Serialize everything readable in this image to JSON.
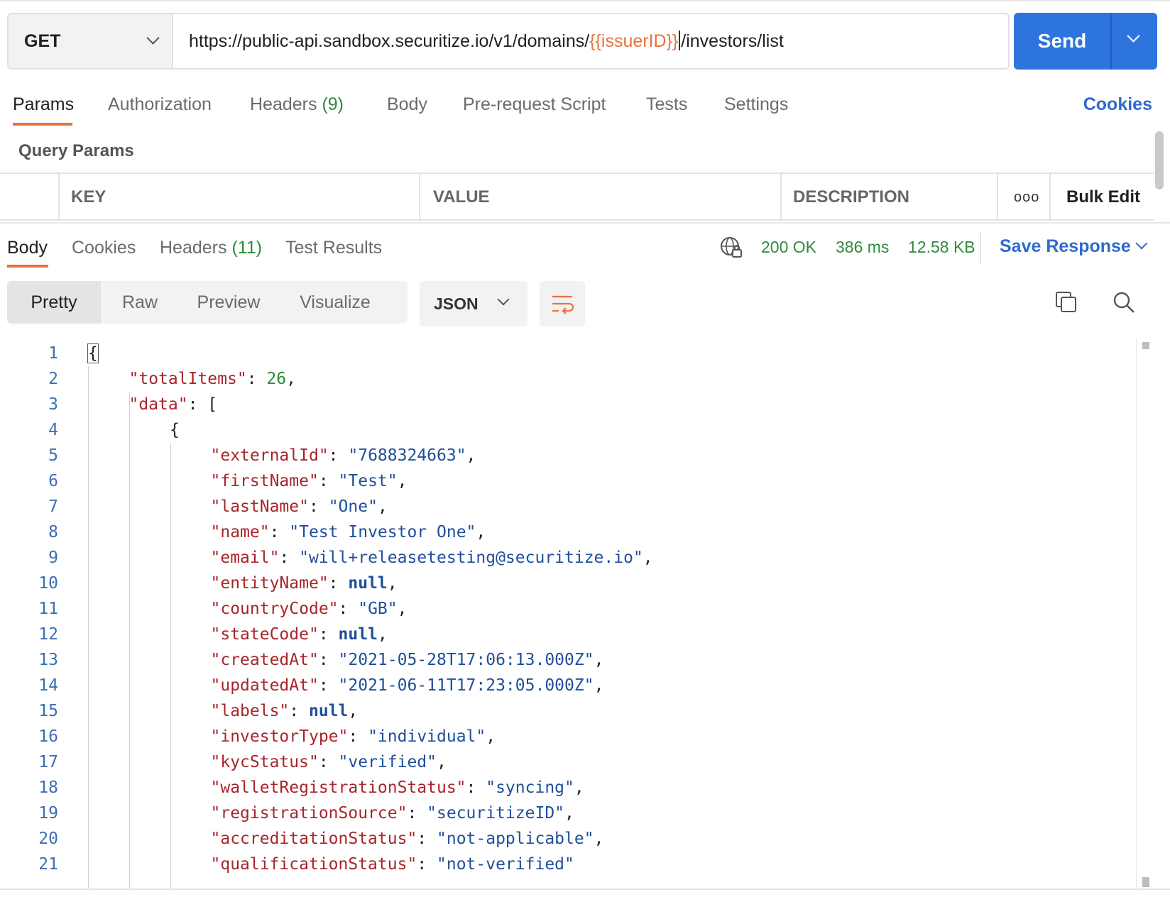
{
  "request": {
    "method": "GET",
    "url_prefix": "https://public-api.sandbox.securitize.io/v1/domains/",
    "url_variable": "{{issuerID}}",
    "url_suffix": "/investors/list",
    "send_label": "Send"
  },
  "request_tabs": [
    {
      "label": "Params",
      "count": ""
    },
    {
      "label": "Authorization",
      "count": ""
    },
    {
      "label": "Headers",
      "count": "(9)"
    },
    {
      "label": "Body",
      "count": ""
    },
    {
      "label": "Pre-request Script",
      "count": ""
    },
    {
      "label": "Tests",
      "count": ""
    },
    {
      "label": "Settings",
      "count": ""
    }
  ],
  "cookies_link": "Cookies",
  "query_params": {
    "title": "Query Params",
    "columns": [
      "KEY",
      "VALUE",
      "DESCRIPTION"
    ],
    "more": "ooo",
    "bulk_edit": "Bulk Edit"
  },
  "response_tabs": [
    {
      "label": "Body",
      "count": ""
    },
    {
      "label": "Cookies",
      "count": ""
    },
    {
      "label": "Headers",
      "count": "(11)"
    },
    {
      "label": "Test Results",
      "count": ""
    }
  ],
  "response_status": {
    "status": "200 OK",
    "time": "386 ms",
    "size": "12.58 KB",
    "save_label": "Save Response",
    "status_color": "#2e8b3e"
  },
  "view_modes": [
    "Pretty",
    "Raw",
    "Preview",
    "Visualize"
  ],
  "format": "JSON",
  "icons": {
    "globe": "globe-lock-icon",
    "wrap": "wrap-lines-icon",
    "copy": "copy-icon",
    "search": "search-icon"
  },
  "colors": {
    "accent": "#e8723c",
    "primary": "#2e74de",
    "link": "#2e6bd1"
  },
  "code_lines": [
    {
      "n": "1",
      "indent": 0,
      "parts": [
        [
          "p",
          "{"
        ]
      ]
    },
    {
      "n": "2",
      "indent": 1,
      "parts": [
        [
          "k",
          "\"totalItems\""
        ],
        [
          "p",
          ": "
        ],
        [
          "n",
          "26"
        ],
        [
          "p",
          ","
        ]
      ]
    },
    {
      "n": "3",
      "indent": 1,
      "parts": [
        [
          "k",
          "\"data\""
        ],
        [
          "p",
          ": ["
        ]
      ]
    },
    {
      "n": "4",
      "indent": 2,
      "parts": [
        [
          "p",
          "{"
        ]
      ]
    },
    {
      "n": "5",
      "indent": 3,
      "parts": [
        [
          "k",
          "\"externalId\""
        ],
        [
          "p",
          ": "
        ],
        [
          "s",
          "\"7688324663\""
        ],
        [
          "p",
          ","
        ]
      ]
    },
    {
      "n": "6",
      "indent": 3,
      "parts": [
        [
          "k",
          "\"firstName\""
        ],
        [
          "p",
          ": "
        ],
        [
          "s",
          "\"Test\""
        ],
        [
          "p",
          ","
        ]
      ]
    },
    {
      "n": "7",
      "indent": 3,
      "parts": [
        [
          "k",
          "\"lastName\""
        ],
        [
          "p",
          ": "
        ],
        [
          "s",
          "\"One\""
        ],
        [
          "p",
          ","
        ]
      ]
    },
    {
      "n": "8",
      "indent": 3,
      "parts": [
        [
          "k",
          "\"name\""
        ],
        [
          "p",
          ": "
        ],
        [
          "s",
          "\"Test Investor One\""
        ],
        [
          "p",
          ","
        ]
      ]
    },
    {
      "n": "9",
      "indent": 3,
      "parts": [
        [
          "k",
          "\"email\""
        ],
        [
          "p",
          ": "
        ],
        [
          "s",
          "\"will+releasetesting@securitize.io\""
        ],
        [
          "p",
          ","
        ]
      ]
    },
    {
      "n": "10",
      "indent": 3,
      "parts": [
        [
          "k",
          "\"entityName\""
        ],
        [
          "p",
          ": "
        ],
        [
          "nl",
          "null"
        ],
        [
          "p",
          ","
        ]
      ]
    },
    {
      "n": "11",
      "indent": 3,
      "parts": [
        [
          "k",
          "\"countryCode\""
        ],
        [
          "p",
          ": "
        ],
        [
          "s",
          "\"GB\""
        ],
        [
          "p",
          ","
        ]
      ]
    },
    {
      "n": "12",
      "indent": 3,
      "parts": [
        [
          "k",
          "\"stateCode\""
        ],
        [
          "p",
          ": "
        ],
        [
          "nl",
          "null"
        ],
        [
          "p",
          ","
        ]
      ]
    },
    {
      "n": "13",
      "indent": 3,
      "parts": [
        [
          "k",
          "\"createdAt\""
        ],
        [
          "p",
          ": "
        ],
        [
          "s",
          "\"2021-05-28T17:06:13.000Z\""
        ],
        [
          "p",
          ","
        ]
      ]
    },
    {
      "n": "14",
      "indent": 3,
      "parts": [
        [
          "k",
          "\"updatedAt\""
        ],
        [
          "p",
          ": "
        ],
        [
          "s",
          "\"2021-06-11T17:23:05.000Z\""
        ],
        [
          "p",
          ","
        ]
      ]
    },
    {
      "n": "15",
      "indent": 3,
      "parts": [
        [
          "k",
          "\"labels\""
        ],
        [
          "p",
          ": "
        ],
        [
          "nl",
          "null"
        ],
        [
          "p",
          ","
        ]
      ]
    },
    {
      "n": "16",
      "indent": 3,
      "parts": [
        [
          "k",
          "\"investorType\""
        ],
        [
          "p",
          ": "
        ],
        [
          "s",
          "\"individual\""
        ],
        [
          "p",
          ","
        ]
      ]
    },
    {
      "n": "17",
      "indent": 3,
      "parts": [
        [
          "k",
          "\"kycStatus\""
        ],
        [
          "p",
          ": "
        ],
        [
          "s",
          "\"verified\""
        ],
        [
          "p",
          ","
        ]
      ]
    },
    {
      "n": "18",
      "indent": 3,
      "parts": [
        [
          "k",
          "\"walletRegistrationStatus\""
        ],
        [
          "p",
          ": "
        ],
        [
          "s",
          "\"syncing\""
        ],
        [
          "p",
          ","
        ]
      ]
    },
    {
      "n": "19",
      "indent": 3,
      "parts": [
        [
          "k",
          "\"registrationSource\""
        ],
        [
          "p",
          ": "
        ],
        [
          "s",
          "\"securitizeID\""
        ],
        [
          "p",
          ","
        ]
      ]
    },
    {
      "n": "20",
      "indent": 3,
      "parts": [
        [
          "k",
          "\"accreditationStatus\""
        ],
        [
          "p",
          ": "
        ],
        [
          "s",
          "\"not-applicable\""
        ],
        [
          "p",
          ","
        ]
      ]
    },
    {
      "n": "21",
      "indent": 3,
      "parts": [
        [
          "k",
          "\"qualificationStatus\""
        ],
        [
          "p",
          ": "
        ],
        [
          "s",
          "\"not-verified\""
        ]
      ]
    }
  ]
}
